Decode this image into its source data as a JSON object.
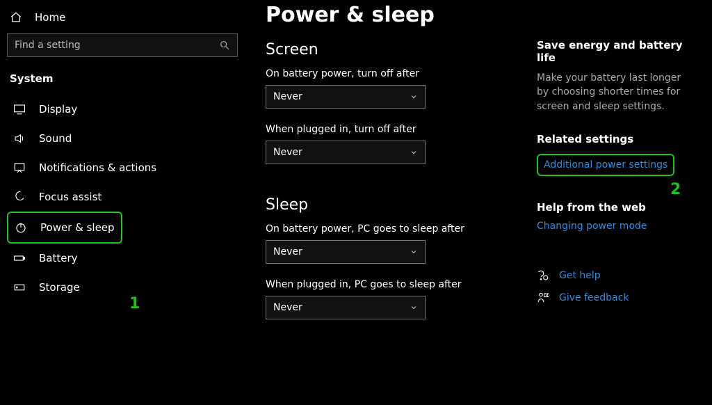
{
  "sidebar": {
    "home": "Home",
    "search_placeholder": "Find a setting",
    "group_title": "System",
    "items": [
      {
        "label": "Display"
      },
      {
        "label": "Sound"
      },
      {
        "label": "Notifications & actions"
      },
      {
        "label": "Focus assist"
      },
      {
        "label": "Power & sleep"
      },
      {
        "label": "Battery"
      },
      {
        "label": "Storage"
      }
    ]
  },
  "main": {
    "title": "Power & sleep",
    "screen": {
      "heading": "Screen",
      "battery_label": "On battery power, turn off after",
      "battery_value": "Never",
      "plugged_label": "When plugged in, turn off after",
      "plugged_value": "Never"
    },
    "sleep": {
      "heading": "Sleep",
      "battery_label": "On battery power, PC goes to sleep after",
      "battery_value": "Never",
      "plugged_label": "When plugged in, PC goes to sleep after",
      "plugged_value": "Never"
    }
  },
  "right": {
    "energy_head": "Save energy and battery life",
    "energy_body": "Make your battery last longer by choosing shorter times for screen and sleep settings.",
    "related_head": "Related settings",
    "related_link": "Additional power settings",
    "help_head": "Help from the web",
    "help_link": "Changing power mode",
    "get_help": "Get help",
    "give_feedback": "Give feedback"
  },
  "annotations": {
    "one": "1",
    "two": "2"
  }
}
